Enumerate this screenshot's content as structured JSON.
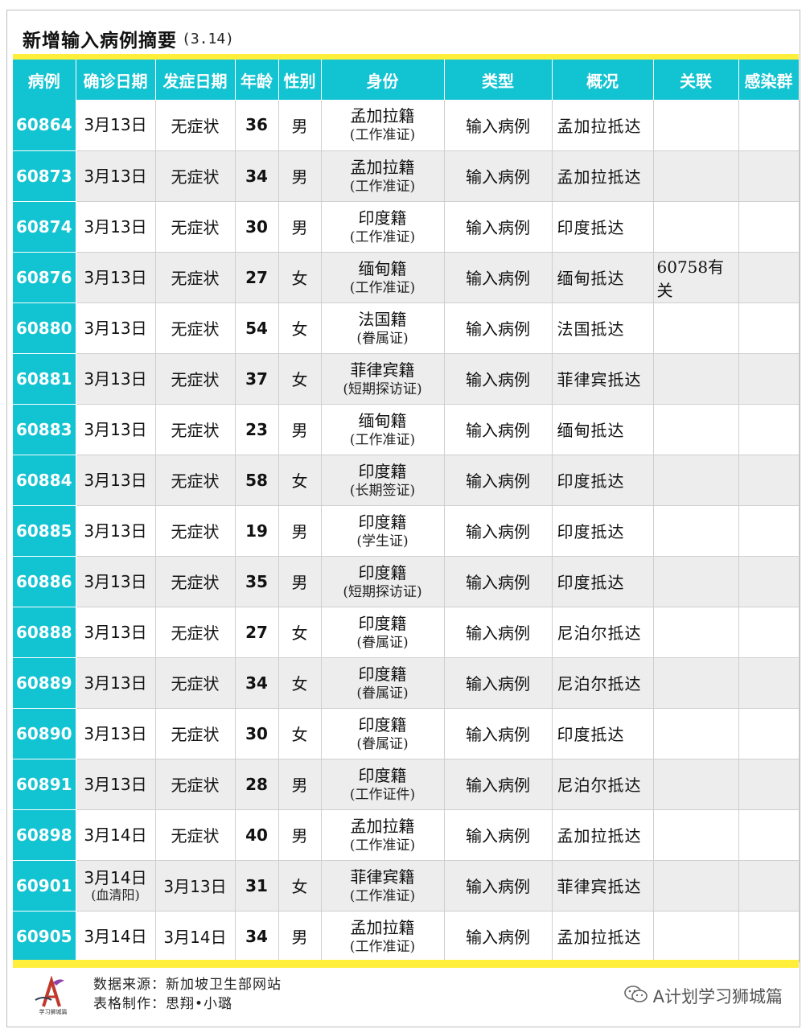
{
  "title": {
    "main": "新增输入病例摘要",
    "date": "(3.14)"
  },
  "headers": [
    "病例",
    "确诊日期",
    "发症日期",
    "年龄",
    "性别",
    "身份",
    "类型",
    "概况",
    "关联",
    "感染群"
  ],
  "rows": [
    {
      "id": "60864",
      "confirm": "3月13日",
      "confirm_note": "",
      "onset": "无症状",
      "onset_red": false,
      "age": "36",
      "sex": "男",
      "nat": "孟加拉籍",
      "pass": "(工作准证)",
      "type": "输入病例",
      "summary": "孟加拉抵达",
      "link": "",
      "cluster": ""
    },
    {
      "id": "60873",
      "confirm": "3月13日",
      "confirm_note": "",
      "onset": "无症状",
      "onset_red": false,
      "age": "34",
      "sex": "男",
      "nat": "孟加拉籍",
      "pass": "(工作准证)",
      "type": "输入病例",
      "summary": "孟加拉抵达",
      "link": "",
      "cluster": ""
    },
    {
      "id": "60874",
      "confirm": "3月13日",
      "confirm_note": "",
      "onset": "无症状",
      "onset_red": false,
      "age": "30",
      "sex": "男",
      "nat": "印度籍",
      "pass": "(工作准证)",
      "type": "输入病例",
      "summary": "印度抵达",
      "link": "",
      "cluster": ""
    },
    {
      "id": "60876",
      "confirm": "3月13日",
      "confirm_note": "",
      "onset": "无症状",
      "onset_red": false,
      "age": "27",
      "sex": "女",
      "nat": "缅甸籍",
      "pass": "(工作准证)",
      "type": "输入病例",
      "summary": "缅甸抵达",
      "link": "60758有关",
      "cluster": ""
    },
    {
      "id": "60880",
      "confirm": "3月13日",
      "confirm_note": "",
      "onset": "无症状",
      "onset_red": false,
      "age": "54",
      "sex": "女",
      "nat": "法国籍",
      "pass": "(眷属证)",
      "type": "输入病例",
      "summary": "法国抵达",
      "link": "",
      "cluster": ""
    },
    {
      "id": "60881",
      "confirm": "3月13日",
      "confirm_note": "",
      "onset": "无症状",
      "onset_red": false,
      "age": "37",
      "sex": "女",
      "nat": "菲律宾籍",
      "pass": "(短期探访证)",
      "type": "输入病例",
      "summary": "菲律宾抵达",
      "link": "",
      "cluster": ""
    },
    {
      "id": "60883",
      "confirm": "3月13日",
      "confirm_note": "",
      "onset": "无症状",
      "onset_red": false,
      "age": "23",
      "sex": "男",
      "nat": "缅甸籍",
      "pass": "(工作准证)",
      "type": "输入病例",
      "summary": "缅甸抵达",
      "link": "",
      "cluster": ""
    },
    {
      "id": "60884",
      "confirm": "3月13日",
      "confirm_note": "",
      "onset": "无症状",
      "onset_red": false,
      "age": "58",
      "sex": "女",
      "nat": "印度籍",
      "pass": "(长期签证)",
      "type": "输入病例",
      "summary": "印度抵达",
      "link": "",
      "cluster": ""
    },
    {
      "id": "60885",
      "confirm": "3月13日",
      "confirm_note": "",
      "onset": "无症状",
      "onset_red": false,
      "age": "19",
      "sex": "男",
      "nat": "印度籍",
      "pass": "(学生证)",
      "type": "输入病例",
      "summary": "印度抵达",
      "link": "",
      "cluster": ""
    },
    {
      "id": "60886",
      "confirm": "3月13日",
      "confirm_note": "",
      "onset": "无症状",
      "onset_red": false,
      "age": "35",
      "sex": "男",
      "nat": "印度籍",
      "pass": "(短期探访证)",
      "type": "输入病例",
      "summary": "印度抵达",
      "link": "",
      "cluster": ""
    },
    {
      "id": "60888",
      "confirm": "3月13日",
      "confirm_note": "",
      "onset": "无症状",
      "onset_red": false,
      "age": "27",
      "sex": "女",
      "nat": "印度籍",
      "pass": "(眷属证)",
      "type": "输入病例",
      "summary": "尼泊尔抵达",
      "link": "",
      "cluster": ""
    },
    {
      "id": "60889",
      "confirm": "3月13日",
      "confirm_note": "",
      "onset": "无症状",
      "onset_red": false,
      "age": "34",
      "sex": "女",
      "nat": "印度籍",
      "pass": "(眷属证)",
      "type": "输入病例",
      "summary": "尼泊尔抵达",
      "link": "",
      "cluster": ""
    },
    {
      "id": "60890",
      "confirm": "3月13日",
      "confirm_note": "",
      "onset": "无症状",
      "onset_red": false,
      "age": "30",
      "sex": "女",
      "nat": "印度籍",
      "pass": "(眷属证)",
      "type": "输入病例",
      "summary": "印度抵达",
      "link": "",
      "cluster": ""
    },
    {
      "id": "60891",
      "confirm": "3月13日",
      "confirm_note": "",
      "onset": "无症状",
      "onset_red": false,
      "age": "28",
      "sex": "男",
      "nat": "印度籍",
      "pass": "(工作证件)",
      "type": "输入病例",
      "summary": "尼泊尔抵达",
      "link": "",
      "cluster": ""
    },
    {
      "id": "60898",
      "confirm": "3月14日",
      "confirm_note": "",
      "onset": "无症状",
      "onset_red": false,
      "age": "40",
      "sex": "男",
      "nat": "孟加拉籍",
      "pass": "(工作准证)",
      "type": "输入病例",
      "summary": "孟加拉抵达",
      "link": "",
      "cluster": ""
    },
    {
      "id": "60901",
      "confirm": "3月14日",
      "confirm_note": "(血清阳)",
      "onset": "3月13日",
      "onset_red": true,
      "age": "31",
      "sex": "女",
      "nat": "菲律宾籍",
      "pass": "(工作准证)",
      "type": "输入病例",
      "summary": "菲律宾抵达",
      "link": "",
      "cluster": ""
    },
    {
      "id": "60905",
      "confirm": "3月14日",
      "confirm_note": "",
      "onset": "3月14日",
      "onset_red": true,
      "age": "34",
      "sex": "男",
      "nat": "孟加拉籍",
      "pass": "(工作准证)",
      "type": "输入病例",
      "summary": "孟加拉抵达",
      "link": "",
      "cluster": ""
    }
  ],
  "footer": {
    "source": "数据来源：新加坡卫生部网站",
    "maker": "表格制作：思翔•小璐",
    "logo_text": "学习狮城篇",
    "wechat_label": "A计划学习狮城篇",
    "wechat_icon": "wechat-icon"
  },
  "colors": {
    "header_bg": "#12c3d2",
    "accent_yellow": "#ffef3a",
    "red": "#e0161b",
    "row_alt": "#ededed"
  }
}
